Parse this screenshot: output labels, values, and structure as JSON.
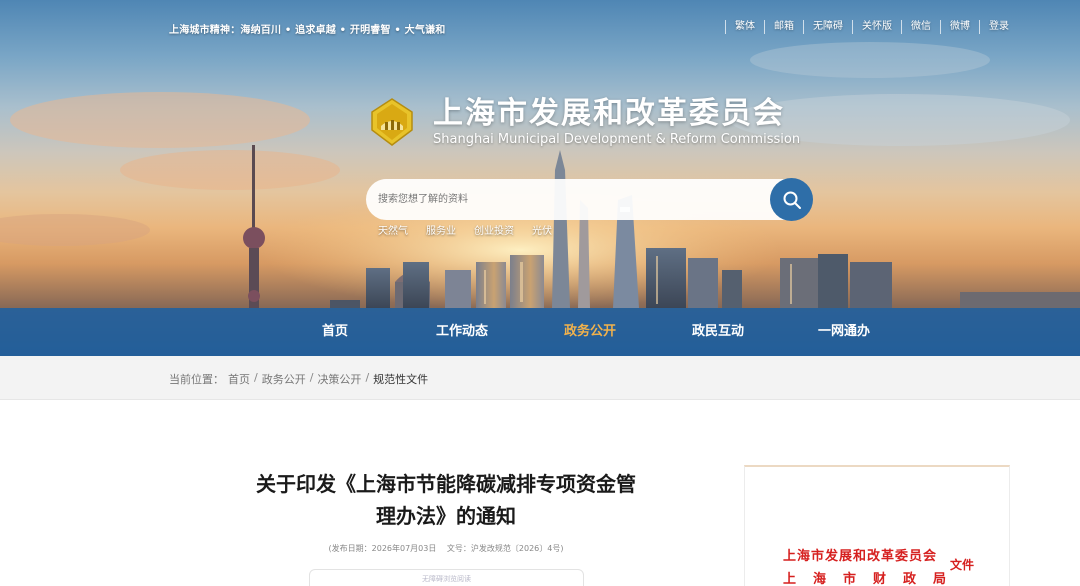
{
  "header": {
    "motto": "上海城市精神：海纳百川 • 追求卓越 • 开明睿智 • 大气谦和",
    "links": [
      "繁体",
      "邮箱",
      "无障碍",
      "关怀版",
      "微信",
      "微博",
      "登录"
    ],
    "title": "上海市发展和改革委员会",
    "subtitle": "Shanghai Municipal Development & Reform Commission"
  },
  "search": {
    "placeholder": "搜索您想了解的资料",
    "hot_tags": [
      "天然气",
      "服务业",
      "创业投资",
      "光伏"
    ]
  },
  "nav": {
    "items": [
      "首页",
      "工作动态",
      "政务公开",
      "政民互动",
      "一网通办"
    ],
    "active": "政务公开"
  },
  "breadcrumb": {
    "label": "当前位置：",
    "items": [
      "首页",
      "政务公开",
      "决策公开"
    ],
    "current": "规范性文件"
  },
  "article": {
    "title_line1": "关于印发《上海市节能降碳减排专项资金管",
    "title_line2": "理办法》的通知",
    "date": "(发布日期：2026年07月03日",
    "doc_no": "文号：沪发改规范〔2026〕4号)",
    "a11y_note": "无障碍浏览阅读"
  },
  "doc_panel": {
    "org1": "上海市发展和改革委员会",
    "org2": "上海市财政局",
    "suffix": "文件"
  },
  "colors": {
    "nav_bg": "#1e60a0",
    "nav_active": "#f2b24c",
    "search_button": "#2e6ea8",
    "doc_red": "#d6201f"
  }
}
